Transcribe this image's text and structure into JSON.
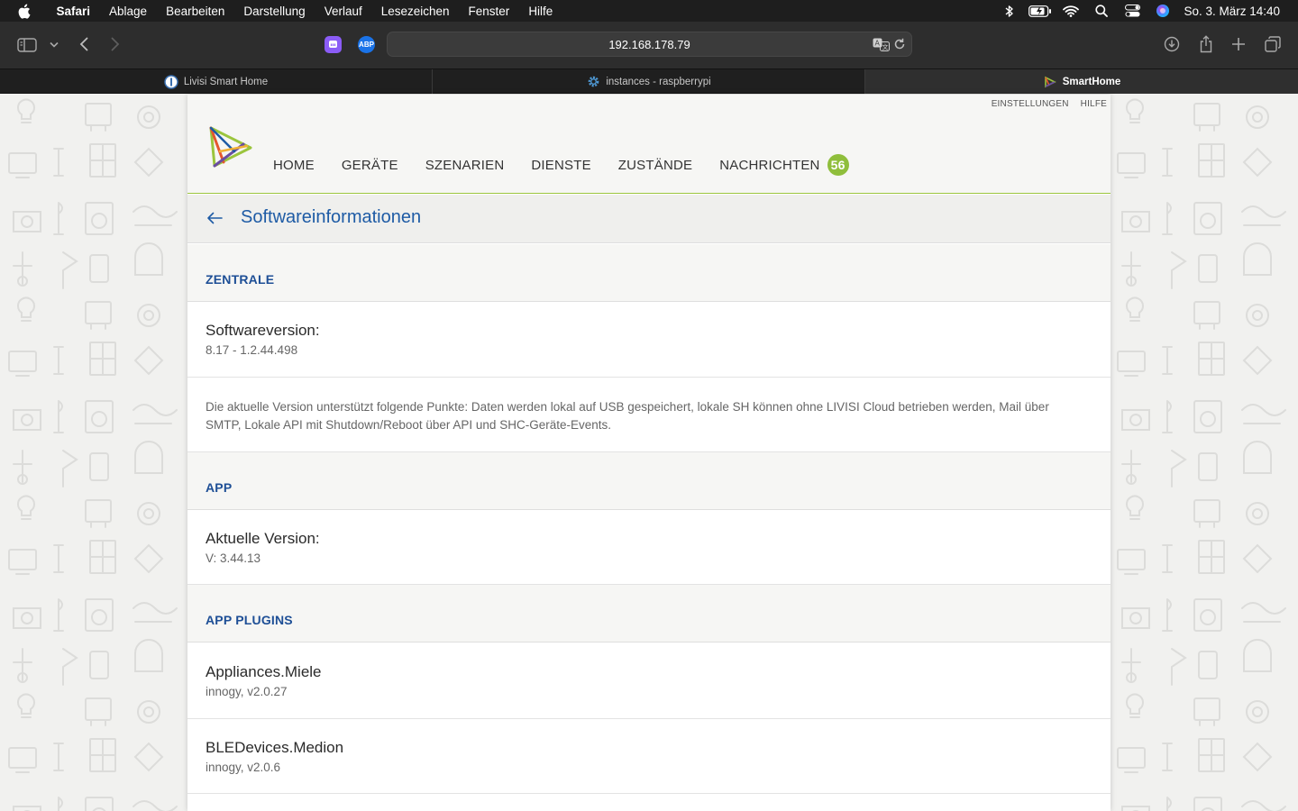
{
  "menubar": {
    "app": "Safari",
    "menus": [
      "Ablage",
      "Bearbeiten",
      "Darstellung",
      "Verlauf",
      "Lesezeichen",
      "Fenster",
      "Hilfe"
    ],
    "clock": "So. 3. März  14:40"
  },
  "toolbar": {
    "url": "192.168.178.79",
    "extension_abp": "ABP"
  },
  "tabs": [
    {
      "label": "Livisi Smart Home",
      "icon": "livisi-favicon",
      "active": false
    },
    {
      "label": "instances - raspberrypi",
      "icon": "gear-favicon",
      "active": false
    },
    {
      "label": "SmartHome",
      "icon": "smarthome-favicon",
      "active": true
    }
  ],
  "header": {
    "links": [
      "EINSTELLUNGEN",
      "HILFE"
    ],
    "nav": [
      "HOME",
      "GERÄTE",
      "SZENARIEN",
      "DIENSTE",
      "ZUSTÄNDE",
      "NACHRICHTEN"
    ],
    "messages_count": "56"
  },
  "page": {
    "title": "Softwareinformationen"
  },
  "sections": {
    "zentrale": {
      "heading": "ZENTRALE",
      "software_label": "Softwareversion:",
      "software_value": "8.17 - 1.2.44.498",
      "description": "Die aktuelle Version unterstützt folgende Punkte: Daten werden lokal auf USB gespeichert, lokale SH können ohne LIVISI Cloud betrieben werden, Mail über SMTP, Lokale API mit Shutdown/Reboot über API und SHC-Geräte-Events."
    },
    "app": {
      "heading": "APP",
      "version_label": "Aktuelle Version:",
      "version_value": "V: 3.44.13"
    },
    "plugins": {
      "heading": "APP PLUGINS",
      "items": [
        {
          "name": "Appliances.Miele",
          "value": "innogy, v2.0.27"
        },
        {
          "name": "BLEDevices.Medion",
          "value": "innogy, v2.0.6"
        }
      ]
    }
  },
  "colors": {
    "accent_blue": "#1e5ba5",
    "accent_green": "#8fbe3b"
  }
}
